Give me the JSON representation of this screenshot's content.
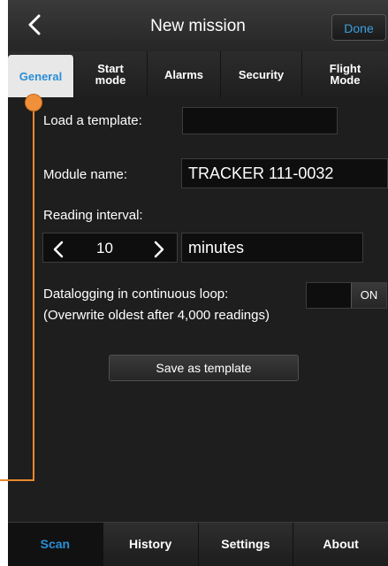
{
  "header": {
    "title": "New mission",
    "done_label": "Done"
  },
  "tabs": [
    {
      "label": "General",
      "active": true
    },
    {
      "label": "Start mode",
      "active": false
    },
    {
      "label": "Alarms",
      "active": false
    },
    {
      "label": "Security",
      "active": false
    },
    {
      "label": "Flight Mode",
      "active": false
    }
  ],
  "form": {
    "template_label": "Load a template:",
    "template_value": "",
    "module_label": "Module name:",
    "module_value": "TRACKER 111-0032",
    "interval_label": "Reading interval:",
    "interval_value": "10",
    "interval_unit": "minutes",
    "loop_label": "Datalogging in continuous loop:",
    "loop_toggle": "ON",
    "loop_note": "(Overwrite oldest after 4,000 readings)",
    "save_template_label": "Save as template"
  },
  "bottom_nav": [
    {
      "label": "Scan",
      "active": true
    },
    {
      "label": "History",
      "active": false
    },
    {
      "label": "Settings",
      "active": false
    },
    {
      "label": "About",
      "active": false
    }
  ],
  "icons": {
    "back": "chevron-left-icon",
    "decrease": "chevron-left-icon",
    "increase": "chevron-right-icon"
  },
  "colors": {
    "accent": "#2a8fd8",
    "done": "#3aa0e0",
    "callout": "#e8892c",
    "background": "#1a1a1a"
  }
}
